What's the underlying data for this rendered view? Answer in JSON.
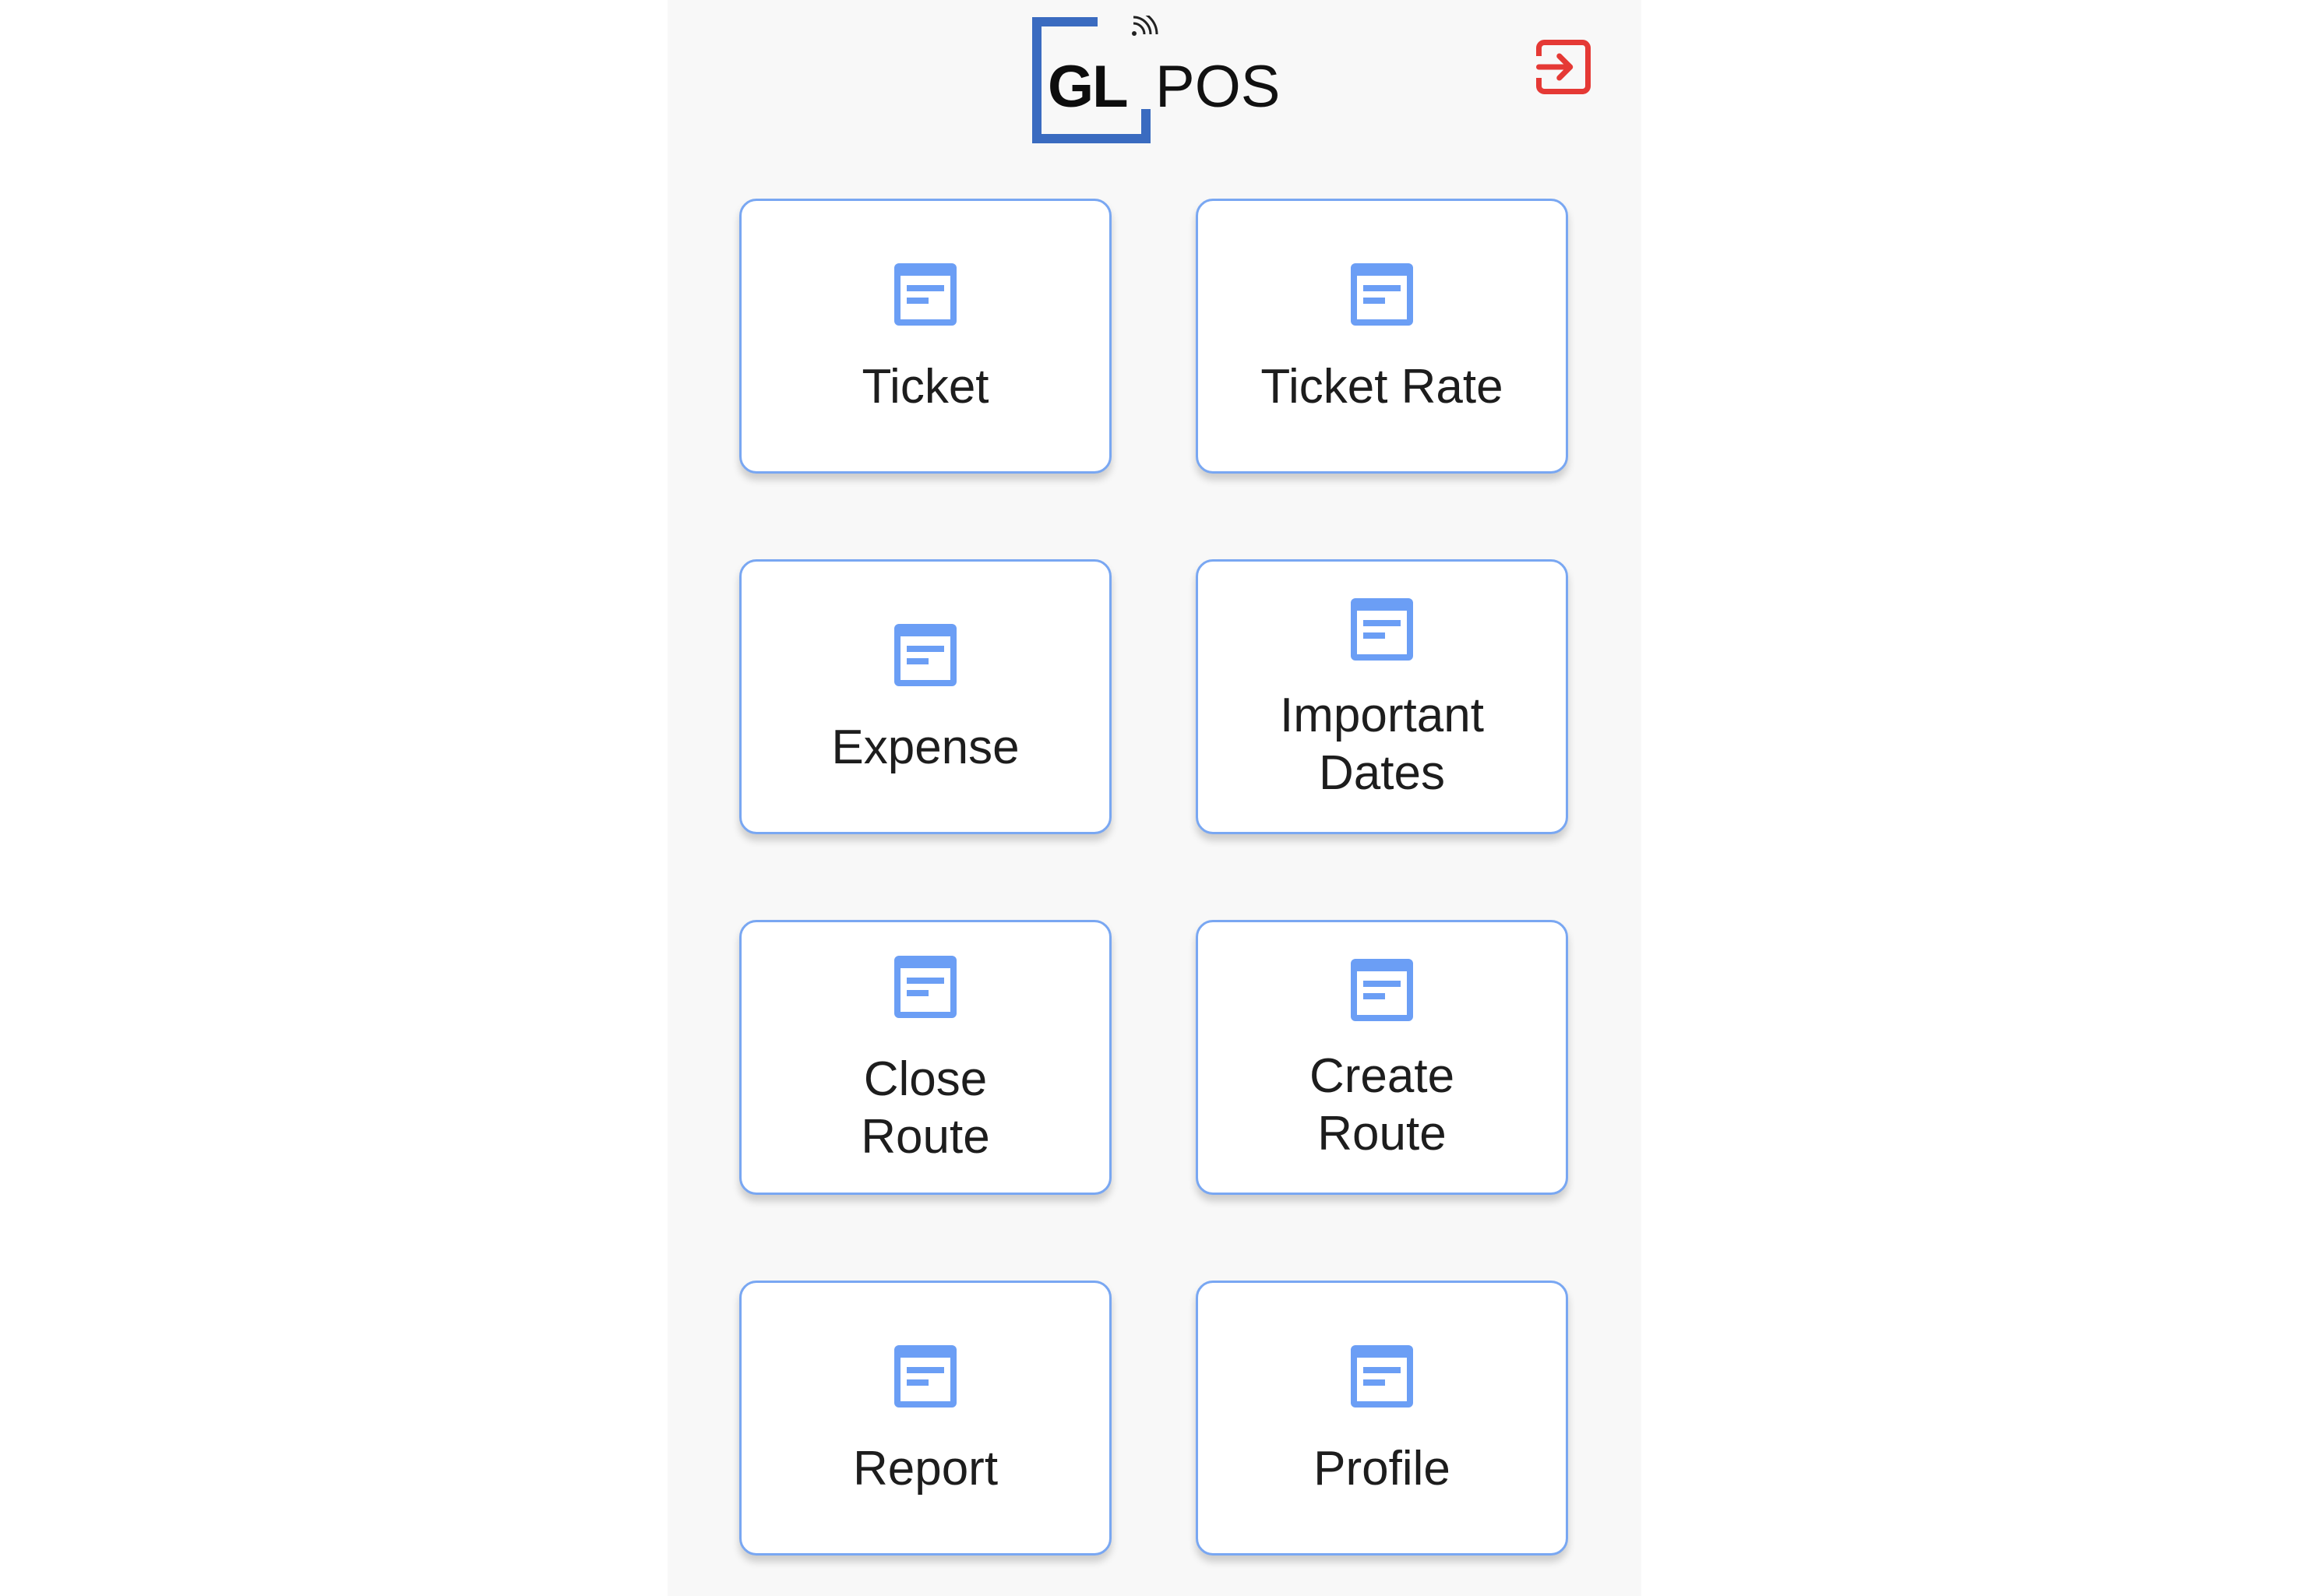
{
  "header": {
    "logo_gl": "GL",
    "logo_pos": "POS",
    "logout_icon": "logout-icon",
    "logout_color": "#e53935"
  },
  "menu": {
    "accent": "#6b9ef5",
    "icon": "notes-card-icon",
    "items": [
      {
        "label": "Ticket"
      },
      {
        "label": "Ticket Rate"
      },
      {
        "label": "Expense"
      },
      {
        "label": "Important Dates"
      },
      {
        "label": "Close Route"
      },
      {
        "label": "Create Route"
      },
      {
        "label": "Report"
      },
      {
        "label": "Profile"
      }
    ]
  }
}
